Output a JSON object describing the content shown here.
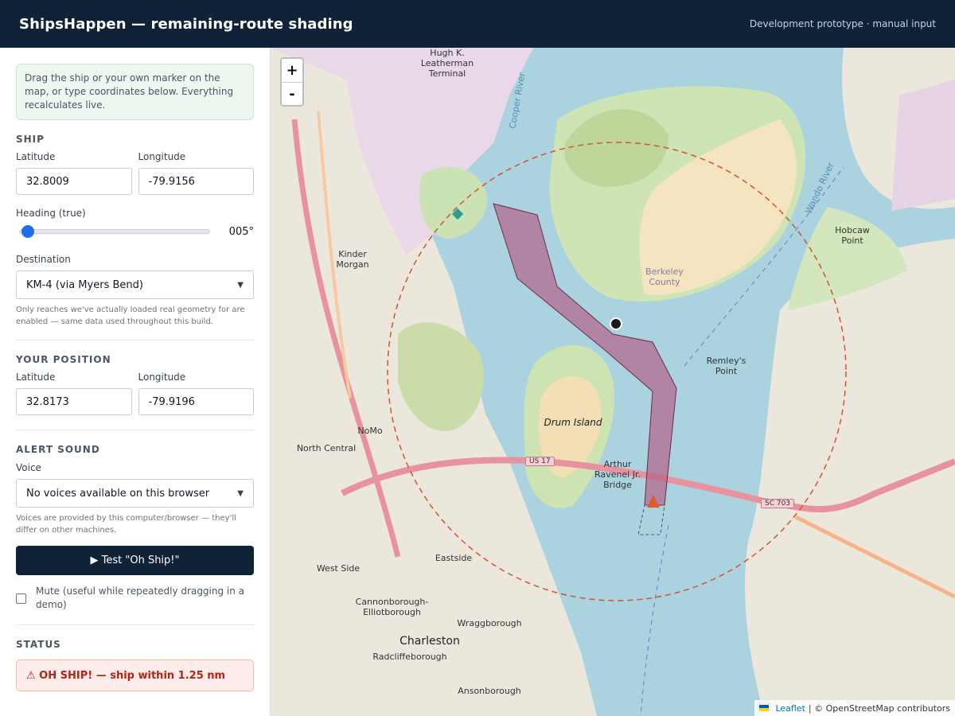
{
  "app": {
    "title": "ShipsHappen — remaining-route shading",
    "subtitle": "Development prototype · manual input"
  },
  "sidebar": {
    "info": "Drag the ship or your own marker on the map, or type coordinates below. Everything recalculates live.",
    "ship": {
      "section": "SHIP",
      "lat_label": "Latitude",
      "lat_value": "32.8009",
      "lon_label": "Longitude",
      "lon_value": "-79.9156",
      "heading_label": "Heading (true)",
      "heading_value": "005°",
      "heading_fraction": 0.014,
      "destination_label": "Destination",
      "destination_value": "KM-4 (via Myers Bend)",
      "destination_hint": "Only reaches we've actually loaded real geometry for are enabled — same data used throughout this build."
    },
    "position": {
      "section": "YOUR POSITION",
      "lat_label": "Latitude",
      "lat_value": "32.8173",
      "lon_label": "Longitude",
      "lon_value": "-79.9196"
    },
    "sound": {
      "section": "ALERT SOUND",
      "voice_label": "Voice",
      "voice_value": "No voices available on this browser",
      "voice_hint": "Voices are provided by this computer/browser — they'll differ on other machines.",
      "test_button": "▶ Test \"Oh Ship!\"",
      "mute_label": "Mute (useful while repeatedly dragging in a demo)"
    },
    "status": {
      "section": "STATUS",
      "alert": "⚠ OH SHIP! — ship within 1.25 nm"
    }
  },
  "map": {
    "zoom_in": "+",
    "zoom_out": "-",
    "attribution_leaflet": "Leaflet",
    "attribution_rest": "| © OpenStreetMap contributors",
    "labels": {
      "terminal": "Hugh K. Leatherman Terminal",
      "drum_island": "Drum Island",
      "bridge": "Arthur Ravenel Jr. Bridge",
      "charleston": "Charleston",
      "hobcaw": "Hobcaw Point",
      "remleys": "Remley's Point",
      "kinder_morgan": "Kinder Morgan",
      "north_central": "North Central",
      "nomo": "NoMo",
      "eastside": "Eastside",
      "westside": "West Side",
      "cannonborough": "Cannonborough-Elliotborough",
      "wraggborough": "Wraggborough",
      "radcliffeborough": "Radcliffeborough",
      "ansonborough": "Ansonborough",
      "berkeley": "Berkeley County",
      "cooper_river": "Cooper River",
      "wando_river": "Wando River",
      "us17": "US 17",
      "sc703": "SC 703"
    }
  },
  "colors": {
    "header": "#0f2238",
    "water": "#aad3df",
    "route_fill": "#b5638a",
    "alert_text": "#b42318",
    "ship": "#e05a2b",
    "radius": "#d0542f"
  }
}
